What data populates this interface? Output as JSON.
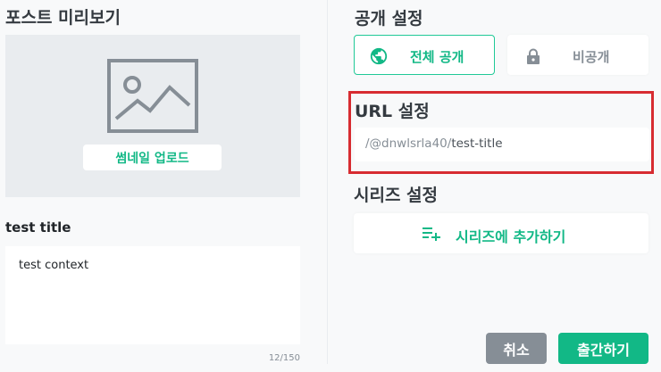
{
  "left": {
    "title": "포스트 미리보기",
    "thumbnail": {
      "icon": "image-icon",
      "upload_label": "썸네일 업로드"
    },
    "post_title": "test title",
    "description": {
      "value": "test context",
      "counter": "12/150"
    }
  },
  "right": {
    "visibility": {
      "title": "공개 설정",
      "public_label": "전체 공개",
      "public_icon": "globe-icon",
      "private_label": "비공개",
      "private_icon": "lock-icon"
    },
    "url": {
      "title": "URL 설정",
      "prefix": "/@dnwlsrla40/",
      "slug": "test-title"
    },
    "series": {
      "title": "시리즈 설정",
      "add_label": "시리즈에 추가하기",
      "add_icon": "playlist-add-icon"
    }
  },
  "actions": {
    "cancel_label": "취소",
    "publish_label": "출간하기"
  },
  "colors": {
    "accent": "#12b886",
    "highlight": "#d72c31",
    "cancel": "#868e96"
  }
}
